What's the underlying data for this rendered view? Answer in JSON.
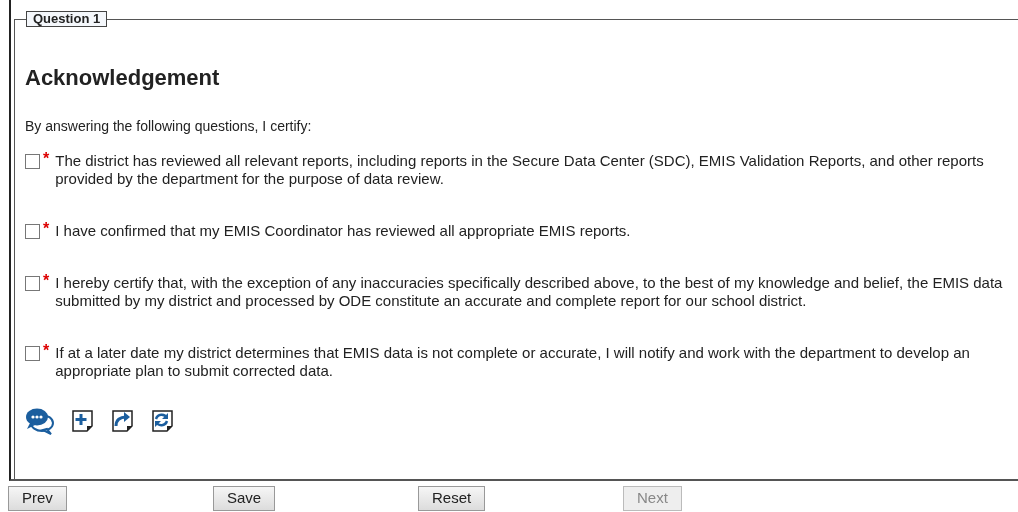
{
  "question": {
    "legend": "Question 1",
    "title": "Acknowledgement",
    "intro": "By answering the following questions, I certify:",
    "items": [
      {
        "checked": false,
        "marker": "*",
        "text": "The district has reviewed all relevant reports, including reports in the Secure Data Center (SDC), EMIS Validation Reports, and other reports provided by the department for the purpose of data review."
      },
      {
        "checked": false,
        "marker": "*",
        "text": "I have confirmed that my EMIS Coordinator has reviewed all appropriate EMIS reports."
      },
      {
        "checked": false,
        "marker": "*",
        "text": "I hereby certify that, with the exception of any inaccuracies specifically described above, to the best of my knowledge and belief, the EMIS data submitted by my district and processed by ODE constitute an accurate and complete report for our school district."
      },
      {
        "checked": false,
        "marker": "*",
        "text": "If at a later date my district determines that EMIS data is not complete or accurate, I will notify and work with the department to develop an appropriate plan to submit corrected data."
      }
    ],
    "tools": [
      {
        "kind": "comment"
      },
      {
        "kind": "add"
      },
      {
        "kind": "share"
      },
      {
        "kind": "refresh"
      }
    ]
  },
  "buttons": [
    {
      "label": "Prev",
      "disabled": false
    },
    {
      "label": "Save",
      "disabled": false
    },
    {
      "label": "Reset",
      "disabled": false
    },
    {
      "label": "Next",
      "disabled": true
    }
  ]
}
